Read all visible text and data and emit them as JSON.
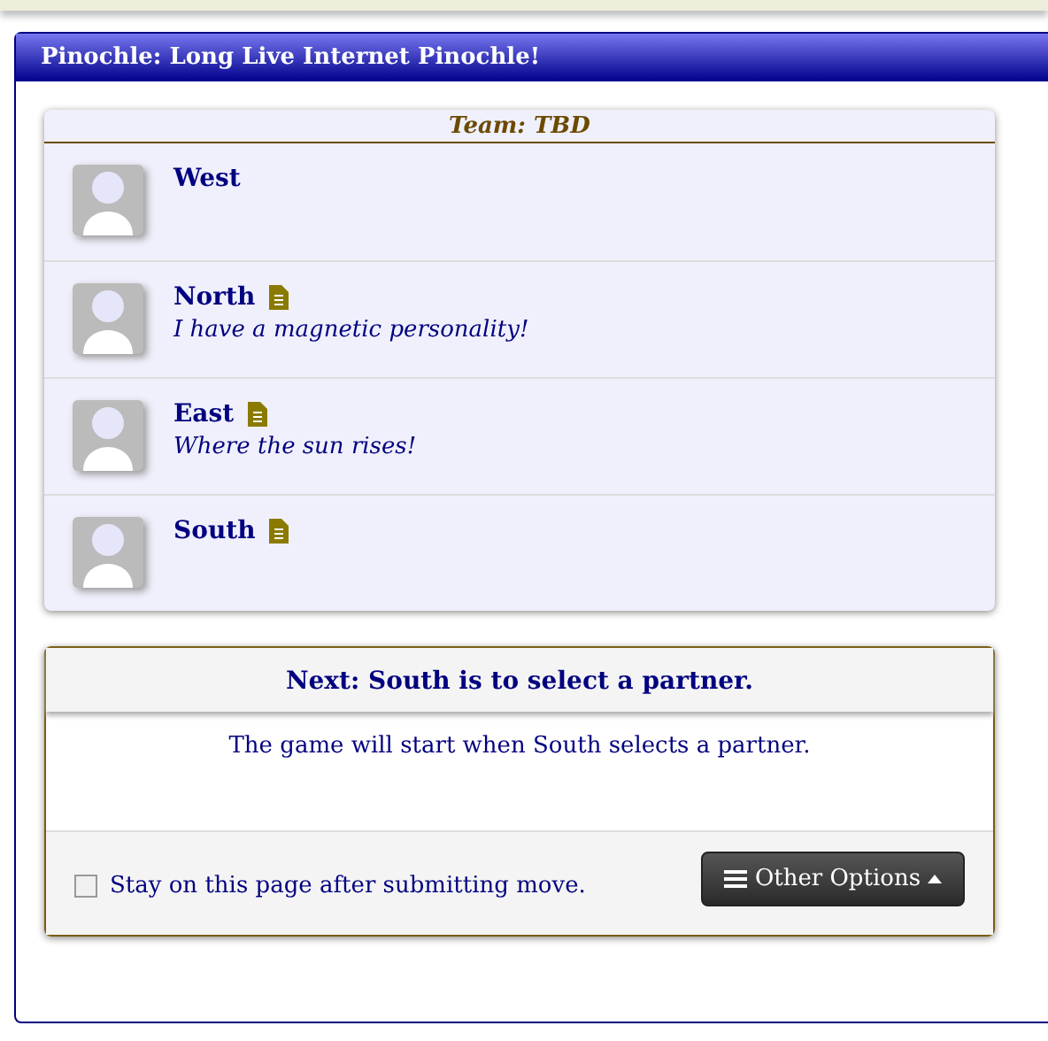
{
  "panel": {
    "title": "Pinochle: Long Live Internet Pinochle!"
  },
  "team": {
    "title": "Team: TBD",
    "players": [
      {
        "name": "West",
        "has_note": false
      },
      {
        "name": "North",
        "has_note": true,
        "motto": "I have a magnetic personality!"
      },
      {
        "name": "East",
        "has_note": true,
        "motto": "Where the sun rises!"
      },
      {
        "name": "South",
        "has_note": true
      }
    ]
  },
  "status": {
    "heading": "Next: South is to select a partner.",
    "message": "The game will start when South selects a partner.",
    "stay_checkbox": {
      "label": "Stay on this page after submitting move.",
      "checked": false
    },
    "options_button": {
      "label": "Other Options"
    }
  }
}
